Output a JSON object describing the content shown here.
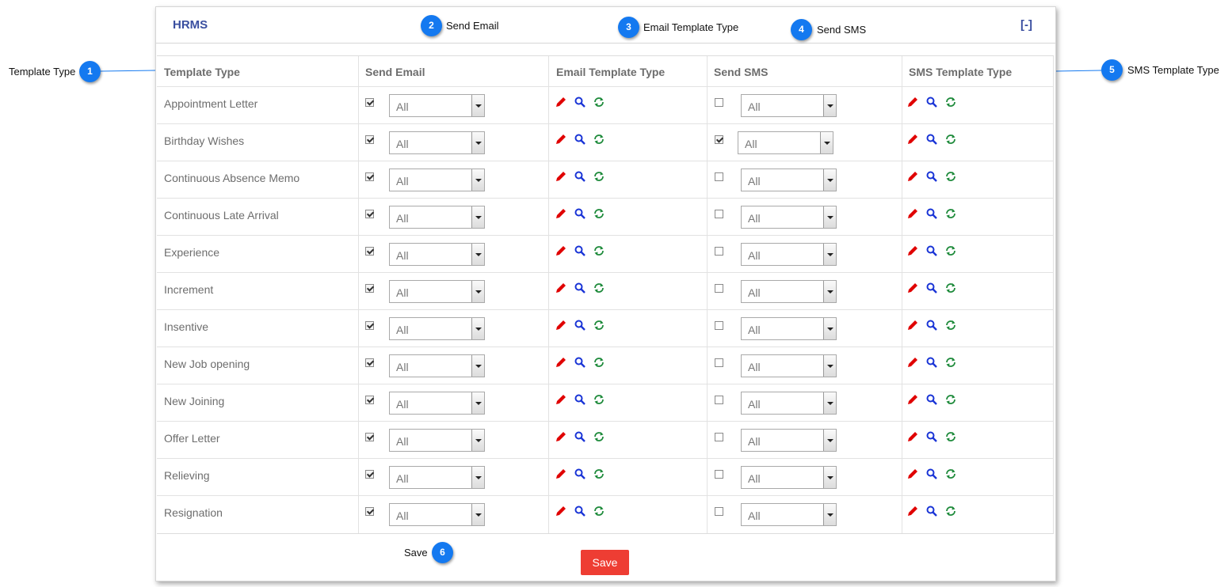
{
  "panel": {
    "title": "HRMS",
    "collapse_label": "[-]"
  },
  "columns": [
    "Template Type",
    "Send Email",
    "Email Template Type",
    "Send SMS",
    "SMS Template Type"
  ],
  "rows": [
    {
      "name": "Appointment Letter",
      "send_email": true,
      "email_filter": "All",
      "send_sms": false,
      "sms_filter": "All"
    },
    {
      "name": "Birthday Wishes",
      "send_email": true,
      "email_filter": "All",
      "send_sms": true,
      "sms_filter": "All"
    },
    {
      "name": "Continuous Absence Memo",
      "send_email": true,
      "email_filter": "All",
      "send_sms": false,
      "sms_filter": "All"
    },
    {
      "name": "Continuous Late Arrival",
      "send_email": true,
      "email_filter": "All",
      "send_sms": false,
      "sms_filter": "All"
    },
    {
      "name": "Experience",
      "send_email": true,
      "email_filter": "All",
      "send_sms": false,
      "sms_filter": "All"
    },
    {
      "name": "Increment",
      "send_email": true,
      "email_filter": "All",
      "send_sms": false,
      "sms_filter": "All"
    },
    {
      "name": "Insentive",
      "send_email": true,
      "email_filter": "All",
      "send_sms": false,
      "sms_filter": "All"
    },
    {
      "name": "New Job opening",
      "send_email": true,
      "email_filter": "All",
      "send_sms": false,
      "sms_filter": "All"
    },
    {
      "name": "New Joining",
      "send_email": true,
      "email_filter": "All",
      "send_sms": false,
      "sms_filter": "All"
    },
    {
      "name": "Offer Letter",
      "send_email": true,
      "email_filter": "All",
      "send_sms": false,
      "sms_filter": "All"
    },
    {
      "name": "Relieving",
      "send_email": true,
      "email_filter": "All",
      "send_sms": false,
      "sms_filter": "All"
    },
    {
      "name": "Resignation",
      "send_email": true,
      "email_filter": "All",
      "send_sms": false,
      "sms_filter": "All"
    }
  ],
  "row_icons": [
    "edit-icon",
    "search-icon",
    "refresh-icon"
  ],
  "save_label": "Save",
  "callouts": [
    {
      "number": "1",
      "label": "Template Type"
    },
    {
      "number": "2",
      "label": "Send Email"
    },
    {
      "number": "3",
      "label": "Email Template Type"
    },
    {
      "number": "4",
      "label": "Send SMS"
    },
    {
      "number": "5",
      "label": "SMS Template Type"
    },
    {
      "number": "6",
      "label": "Save"
    }
  ],
  "colors": {
    "accent": "#3a4fa0",
    "save": "#ee3d33",
    "callout": "#1479f0",
    "edit": "#e00000",
    "search": "#1a35d6",
    "refresh": "#1d8a3a"
  }
}
